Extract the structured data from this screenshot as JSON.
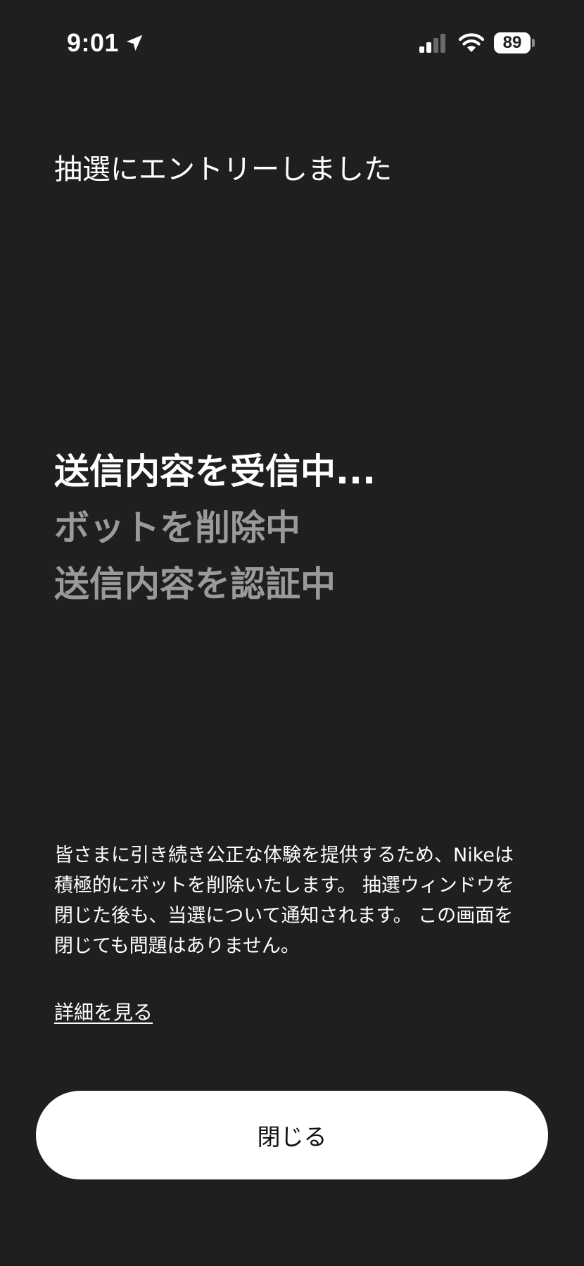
{
  "status_bar": {
    "time": "9:01",
    "battery": "89",
    "icons": [
      "location-arrow-icon",
      "cellular-signal-icon",
      "wifi-icon",
      "battery-icon"
    ]
  },
  "header": {
    "title": "抽選にエントリーしました"
  },
  "steps": [
    {
      "label": "送信内容を受信中...",
      "state": "active"
    },
    {
      "label": "ボットを削除中",
      "state": "pending"
    },
    {
      "label": "送信内容を認証中",
      "state": "pending"
    }
  ],
  "info": {
    "description": "皆さまに引き続き公正な体験を提供するため、Nikeは積極的にボットを削除いたします。 抽選ウィンドウを閉じた後も、当選について通知されます。 この画面を閉じても問題はありません。",
    "details_link": "詳細を見る"
  },
  "actions": {
    "close_label": "閉じる"
  },
  "colors": {
    "background": "#1f1f1f",
    "text_primary": "#ffffff",
    "text_pending": "#9a9a9a",
    "button_bg": "#ffffff",
    "button_text": "#111111"
  }
}
